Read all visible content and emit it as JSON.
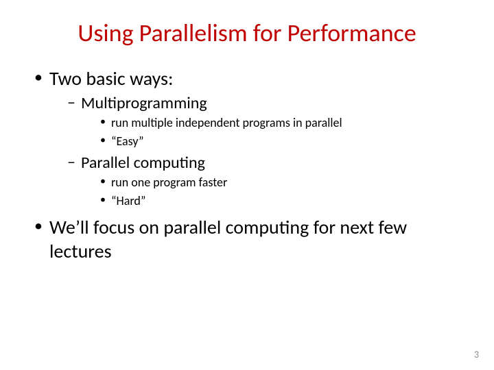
{
  "title": "Using Parallelism for Performance",
  "bullets": {
    "b1": "Two basic ways:",
    "b1a": "Multiprogramming",
    "b1a_i": "run multiple independent programs in parallel",
    "b1a_ii": "“Easy”",
    "b1b": "Parallel computing",
    "b1b_i": "run one program faster",
    "b1b_ii": "“Hard”",
    "b2": "We’ll focus on parallel computing for next few lectures"
  },
  "page_number": "3"
}
